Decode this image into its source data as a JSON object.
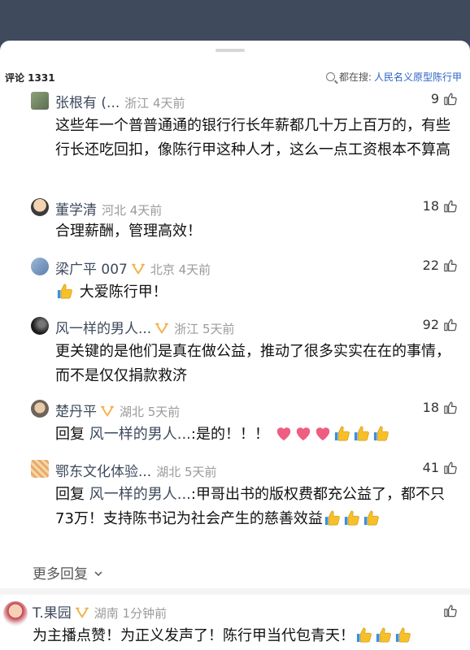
{
  "header": {
    "comment_count": "评论 1331",
    "search_prefix": "都在搜:",
    "search_keyword": "人民名义原型陈行甲"
  },
  "comments": [
    {
      "user": "张根有 (...",
      "location_time": "浙江 4天前",
      "likes": "9",
      "text": "这些年一个普普通通的银行行长年薪都几十万上百万的，有些行长还吃回扣，像陈行甲这种人才，这么一点工资根本不算高"
    },
    {
      "user": "董学清",
      "location_time": "河北 4天前",
      "likes": "18",
      "text": "合理薪酬，管理高效！"
    },
    {
      "user": "梁广平 007",
      "location_time": "北京 4天前",
      "likes": "22",
      "text": "大爱陈行甲！"
    },
    {
      "user": "风一样的男人...",
      "location_time": "浙江 5天前",
      "likes": "92",
      "text": "更关键的是他们是真在做公益，推动了很多实实在在的事情，而不是仅仅捐款救济"
    },
    {
      "user": "楚丹平",
      "location_time": "湖北 5天前",
      "likes": "18",
      "reply_prefix": "回复 ",
      "reply_to": "风一样的男人...",
      "text": ":是的！！！"
    },
    {
      "user": "鄂东文化体验...",
      "location_time": "湖北 5天前",
      "likes": "41",
      "reply_prefix": "回复 ",
      "reply_to": "风一样的男人...",
      "text": ":甲哥出书的版权费都充公益了，都不只73万！支持陈书记为社会产生的慈善效益"
    },
    {
      "user": "T.果园",
      "location_time": "湖南 1分钟前",
      "likes": "",
      "text": "为主播点赞！为正义发声了！陈行甲当代包青天！"
    }
  ],
  "more_replies": "更多回复",
  "colors": {
    "accent": "#2b64c6",
    "username": "#3d4a5c",
    "meta": "#9a9a9a",
    "badge": "#f2b24a"
  }
}
